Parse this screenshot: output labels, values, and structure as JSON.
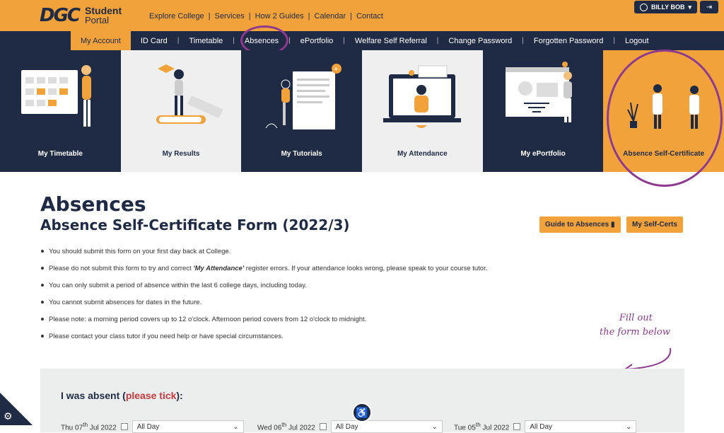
{
  "header": {
    "logo_mark": "DGC",
    "logo_word1": "Student",
    "logo_word2": "Portal",
    "nav": [
      "Explore College",
      "Services",
      "How 2 Guides",
      "Calendar",
      "Contact"
    ],
    "user_name": "BILLY BOB",
    "user_icon": "user-circle-icon",
    "logout_icon": "sign-out-icon"
  },
  "subnav": {
    "items": [
      "My Account",
      "ID Card",
      "Timetable",
      "Absences",
      "ePortfolio",
      "Welfare Self Referral",
      "Change Password",
      "Forgotten Password",
      "Logout"
    ],
    "active": "My Account"
  },
  "tiles": [
    {
      "label": "My Timetable",
      "style": "dark"
    },
    {
      "label": "My Results",
      "style": "light"
    },
    {
      "label": "My Tutorials",
      "style": "dark"
    },
    {
      "label": "My Attendance",
      "style": "light"
    },
    {
      "label": "My ePortfolio",
      "style": "dark"
    },
    {
      "label": "Absence Self-Certificate",
      "style": "orange"
    }
  ],
  "page": {
    "title": "Absences",
    "subtitle": "Absence Self-Certificate Form (2022/3)",
    "guide_button": "Guide to Absences",
    "guide_icon": "book-icon",
    "selfcerts_button": "My Self-Certs"
  },
  "instructions": [
    {
      "pre": "You should submit this form on your first day back at College.",
      "em": "",
      "post": ""
    },
    {
      "pre": "Please do not submit this form to try and correct ",
      "em": "'My Attendance'",
      "post": " register errors. If your attendance looks wrong, please speak to your course tutor."
    },
    {
      "pre": "You can only submit a period of absence within the last 6 college days, including today.",
      "em": "",
      "post": ""
    },
    {
      "pre": "You cannot submit absences for dates in the future.",
      "em": "",
      "post": ""
    },
    {
      "pre": "Please note: a morning period covers up to 12 o'clock. Afternoon period covers from 12 o'clock to midnight.",
      "em": "",
      "post": ""
    },
    {
      "pre": "Please contact your class tutor if you need help or have special circumstances.",
      "em": "",
      "post": ""
    }
  ],
  "annotation": {
    "line1": "Fill out",
    "line2": "the form below"
  },
  "form": {
    "question": "I was absent (",
    "question_red": "please tick",
    "question_end": "):",
    "days": [
      {
        "day": "Thu",
        "date_num": "07",
        "suffix": "th",
        "month_year": "Jul 2022",
        "period": "All Day"
      },
      {
        "day": "Wed",
        "date_num": "06",
        "suffix": "th",
        "month_year": "Jul 2022",
        "period": "All Day"
      },
      {
        "day": "Tue",
        "date_num": "05",
        "suffix": "th",
        "month_year": "Jul 2022",
        "period": "All Day"
      }
    ]
  },
  "colors": {
    "brand_orange": "#f2a23a",
    "navy": "#1f2a44",
    "annotation_purple": "#8e3a8e",
    "red": "#d0393b"
  }
}
